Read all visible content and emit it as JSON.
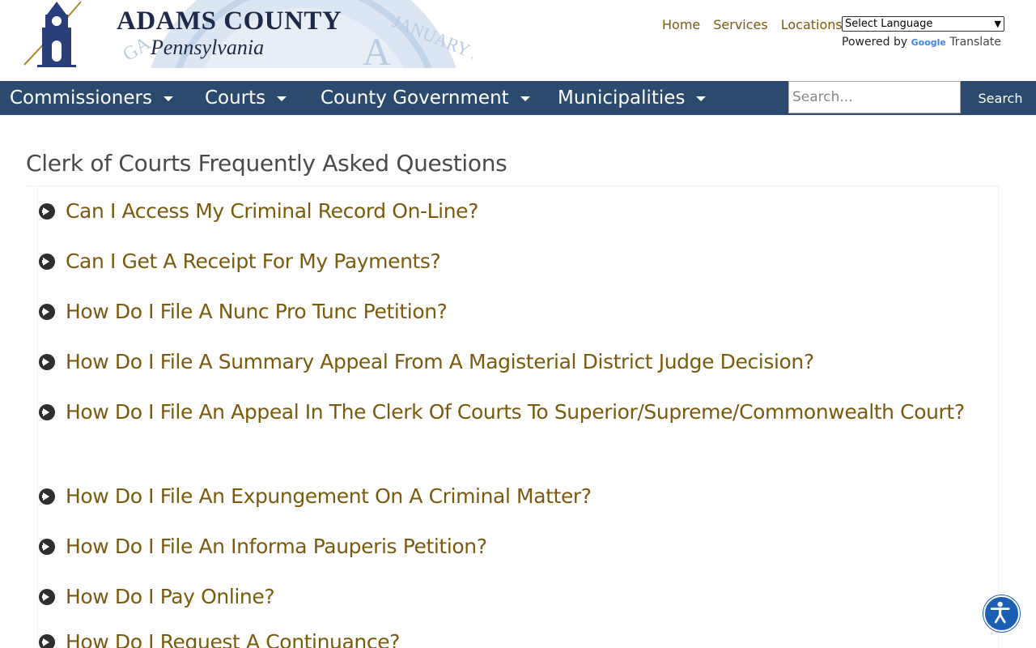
{
  "header": {
    "logo_title": "ADAMS COUNTY",
    "logo_subtitle": "Pennsylvania",
    "top_links": [
      "Home",
      "Services",
      "Locations"
    ],
    "language_select": "Select Language",
    "powered_by": "Powered by",
    "google": "Google",
    "translate": "Translate"
  },
  "nav": {
    "items": [
      "Commissioners",
      "Courts",
      "County Government",
      "Municipalities"
    ],
    "search_placeholder": "Search...",
    "search_button": "Search",
    "bar_color": "#2c4a6e"
  },
  "main": {
    "title": "Clerk of Courts Frequently Asked Questions",
    "faqs": [
      "Can I Access My Criminal Record On-Line?",
      "Can I Get A Receipt For My Payments?",
      "How Do I File A Nunc Pro Tunc Petition?",
      "How Do I File A Summary Appeal From A Magisterial District Judge Decision?",
      "How Do I File An Appeal In The Clerk Of Courts To Superior/Supreme/Commonwealth Court?",
      "How Do I File An Expungement On A Criminal Matter?",
      "How Do I File An Informa Pauperis Petition?",
      "How Do I Pay Online?",
      "How Do I Request A Continuance?"
    ],
    "link_color": "#7a5b0e",
    "icon": "arrow-circle-right-icon"
  },
  "accessibility": {
    "icon": "accessibility-icon"
  }
}
